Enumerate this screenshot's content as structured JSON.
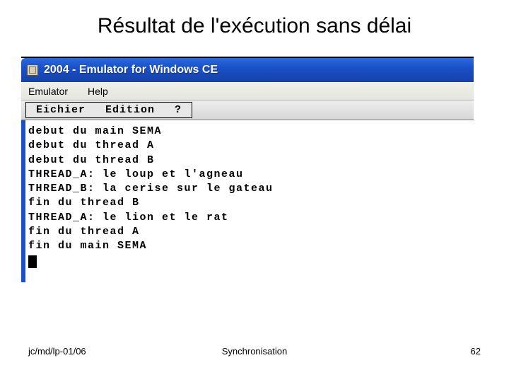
{
  "slide": {
    "title": "Résultat de l'exécution sans délai"
  },
  "window": {
    "title": "2004 - Emulator for Windows CE",
    "menubar": {
      "items": [
        "Emulator",
        "Help"
      ]
    },
    "submenubar": {
      "items": [
        "Eichier",
        "Edition",
        "?"
      ]
    }
  },
  "console": {
    "lines": [
      "debut du main SEMA",
      "debut du thread A",
      "debut du thread B",
      "THREAD_A: le loup et l'agneau",
      "THREAD_B: la cerise sur le gateau",
      "fin du thread B",
      "THREAD_A: le lion et le rat",
      "fin du thread A",
      "fin du main SEMA"
    ]
  },
  "footer": {
    "left": "jc/md/lp-01/06",
    "center": "Synchronisation",
    "right": "62"
  }
}
